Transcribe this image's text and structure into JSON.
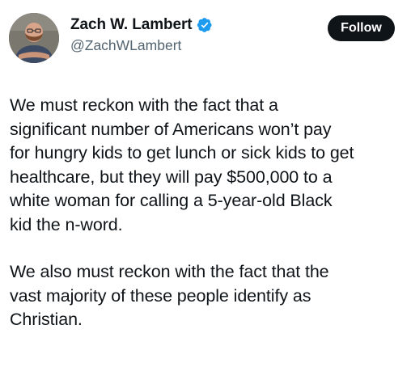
{
  "author": {
    "display_name": "Zach W. Lambert",
    "handle": "@ZachWLambert",
    "verified": true,
    "verified_icon": "verified-badge-icon"
  },
  "actions": {
    "follow_label": "Follow"
  },
  "tweet": {
    "paragraphs": [
      {
        "lines": [
          "We must reckon with the fact that a",
          "significant number of Americans won’t pay",
          "for hungry kids to get lunch or sick kids to get",
          "healthcare, but they will pay $500,000 to a",
          "white woman for calling a 5-year-old Black",
          "kid the n-word."
        ]
      },
      {
        "lines": [
          "We also must reckon with the fact that the",
          "vast majority of these people identify as",
          "Christian."
        ]
      }
    ]
  },
  "colors": {
    "text_primary": "#0f1419",
    "text_secondary": "#536471",
    "verified_blue": "#1d9bf0",
    "follow_bg": "#0f1419",
    "follow_text": "#ffffff"
  }
}
